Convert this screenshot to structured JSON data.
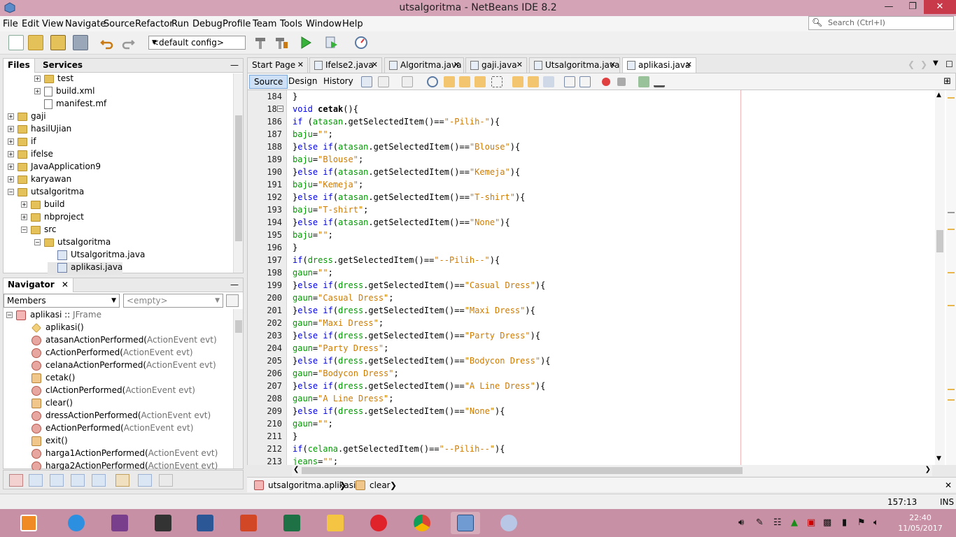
{
  "window": {
    "title": "utsalgoritma - NetBeans IDE 8.2",
    "minimize": "—",
    "maximize": "❐",
    "close": "✕"
  },
  "menu": [
    "File",
    "Edit",
    "View",
    "Navigate",
    "Source",
    "Refactor",
    "Run",
    "Debug",
    "Profile",
    "Team",
    "Tools",
    "Window",
    "Help"
  ],
  "search": {
    "placeholder": "Search (Ctrl+I)"
  },
  "toolbar": {
    "config": "<default config>"
  },
  "projects_panel": {
    "tabs": [
      "Files",
      "Services"
    ],
    "minimize": "—",
    "rows": [
      {
        "label": "test",
        "indent": 2,
        "icon": "folder",
        "exp": "+"
      },
      {
        "label": "build.xml",
        "indent": 2,
        "icon": "file",
        "exp": "+"
      },
      {
        "label": "manifest.mf",
        "indent": 2,
        "icon": "file",
        "exp": ""
      },
      {
        "label": "gaji",
        "indent": 0,
        "icon": "folder",
        "exp": "+"
      },
      {
        "label": "hasilUjian",
        "indent": 0,
        "icon": "folder",
        "exp": "+"
      },
      {
        "label": "if",
        "indent": 0,
        "icon": "folder",
        "exp": "+"
      },
      {
        "label": "ifelse",
        "indent": 0,
        "icon": "folder",
        "exp": "+"
      },
      {
        "label": "JavaApplication9",
        "indent": 0,
        "icon": "folder",
        "exp": "+"
      },
      {
        "label": "karyawan",
        "indent": 0,
        "icon": "folder",
        "exp": "+"
      },
      {
        "label": "utsalgoritma",
        "indent": 0,
        "icon": "folder",
        "exp": "−"
      },
      {
        "label": "build",
        "indent": 1,
        "icon": "folder",
        "exp": "+"
      },
      {
        "label": "nbproject",
        "indent": 1,
        "icon": "folder",
        "exp": "+"
      },
      {
        "label": "src",
        "indent": 1,
        "icon": "folder",
        "exp": "−"
      },
      {
        "label": "utsalgoritma",
        "indent": 2,
        "icon": "folder",
        "exp": "−"
      },
      {
        "label": "Utsalgoritma.java",
        "indent": 3,
        "icon": "jfile",
        "exp": ""
      },
      {
        "label": "aplikasi.java",
        "indent": 3,
        "icon": "jfile",
        "exp": "",
        "selected": true
      }
    ]
  },
  "navigator": {
    "title": "Navigator",
    "close": "✕",
    "minimize": "—",
    "members_combo": "Members",
    "filter_combo": "<empty>",
    "root": {
      "name": "aplikasi",
      "sep": " :: ",
      "type": "JFrame"
    },
    "members": [
      {
        "name": "aplikasi()",
        "param": "",
        "icon": "diamond"
      },
      {
        "name": "atasanActionPerformed(",
        "param": "ActionEvent evt)",
        "icon": "red"
      },
      {
        "name": "cActionPerformed(",
        "param": "ActionEvent evt)",
        "icon": "red"
      },
      {
        "name": "celanaActionPerformed(",
        "param": "ActionEvent evt)",
        "icon": "red"
      },
      {
        "name": "cetak()",
        "param": "",
        "icon": "orange"
      },
      {
        "name": "clActionPerformed(",
        "param": "ActionEvent evt)",
        "icon": "red"
      },
      {
        "name": "clear()",
        "param": "",
        "icon": "orange"
      },
      {
        "name": "dressActionPerformed(",
        "param": "ActionEvent evt)",
        "icon": "red"
      },
      {
        "name": "eActionPerformed(",
        "param": "ActionEvent evt)",
        "icon": "red"
      },
      {
        "name": "exit()",
        "param": "",
        "icon": "orange"
      },
      {
        "name": "harga1ActionPerformed(",
        "param": "ActionEvent evt)",
        "icon": "red"
      },
      {
        "name": "harga2ActionPerformed(",
        "param": "ActionEvent evt)",
        "icon": "red"
      }
    ]
  },
  "editor": {
    "tabs": [
      "Start Page",
      "Ifelse2.java",
      "Algoritma.java",
      "gaji.java",
      "Utsalgoritma.java",
      "aplikasi.java"
    ],
    "active_tab": "aplikasi.java",
    "views": [
      "Source",
      "Design",
      "History"
    ],
    "active_view": "Source",
    "lines": [
      {
        "n": "184",
        "t": "}"
      },
      {
        "n": "185",
        "t": "void cetak(){"
      },
      {
        "n": "186",
        "t": "if (atasan.getSelectedItem()==\"-Pilih-\"){"
      },
      {
        "n": "187",
        "t": "baju=\"\";"
      },
      {
        "n": "188",
        "t": "}else if(atasan.getSelectedItem()==\"Blouse\"){"
      },
      {
        "n": "189",
        "t": "baju=\"Blouse\";"
      },
      {
        "n": "190",
        "t": "}else if(atasan.getSelectedItem()==\"Kemeja\"){"
      },
      {
        "n": "191",
        "t": "baju=\"Kemeja\";"
      },
      {
        "n": "192",
        "t": "}else if(atasan.getSelectedItem()==\"T-shirt\"){"
      },
      {
        "n": "193",
        "t": "baju=\"T-shirt\";"
      },
      {
        "n": "194",
        "t": "}else if(atasan.getSelectedItem()==\"None\"){"
      },
      {
        "n": "195",
        "t": "baju=\"\";"
      },
      {
        "n": "196",
        "t": "}"
      },
      {
        "n": "197",
        "t": "if(dress.getSelectedItem()==\"--Pilih--\"){"
      },
      {
        "n": "198",
        "t": "gaun=\"\";"
      },
      {
        "n": "199",
        "t": "}else if(dress.getSelectedItem()==\"Casual Dress\"){"
      },
      {
        "n": "200",
        "t": "gaun=\"Casual Dress\";"
      },
      {
        "n": "201",
        "t": "}else if(dress.getSelectedItem()==\"Maxi Dress\"){"
      },
      {
        "n": "202",
        "t": "gaun=\"Maxi Dress\";"
      },
      {
        "n": "203",
        "t": "}else if(dress.getSelectedItem()==\"Party Dress\"){"
      },
      {
        "n": "204",
        "t": "gaun=\"Party Dress\";"
      },
      {
        "n": "205",
        "t": "}else if(dress.getSelectedItem()==\"Bodycon Dress\"){"
      },
      {
        "n": "206",
        "t": "gaun=\"Bodycon Dress\";"
      },
      {
        "n": "207",
        "t": "}else if(dress.getSelectedItem()==\"A Line Dress\"){"
      },
      {
        "n": "208",
        "t": "gaun=\"A Line Dress\";"
      },
      {
        "n": "209",
        "t": "}else if(dress.getSelectedItem()==\"None\"){"
      },
      {
        "n": "210",
        "t": "gaun=\"\";"
      },
      {
        "n": "211",
        "t": "}"
      },
      {
        "n": "212",
        "t": "if(celana.getSelectedItem()==\"--Pilih--\"){"
      },
      {
        "n": "213",
        "t": "jeans=\"\";"
      }
    ]
  },
  "breadcrumb": [
    "utsalgoritma.aplikasi",
    "clear"
  ],
  "status": {
    "position": "157:13",
    "mode": "INS"
  },
  "taskbar": {
    "apps": [
      "media-player-icon",
      "internet-explorer-icon",
      "winrar-icon",
      "media-player-classic-icon",
      "word-icon",
      "powerpoint-icon",
      "excel-icon",
      "file-explorer-icon",
      "opera-icon",
      "chrome-icon",
      "netbeans-icon",
      "paint-icon"
    ],
    "time": "22:40",
    "date": "11/05/2017"
  },
  "colors": {
    "titlebar": "#d4a3b6",
    "taskbar": "#c890a4",
    "keyword": "#0000e6",
    "string": "#ce7b00",
    "field": "#009900"
  }
}
